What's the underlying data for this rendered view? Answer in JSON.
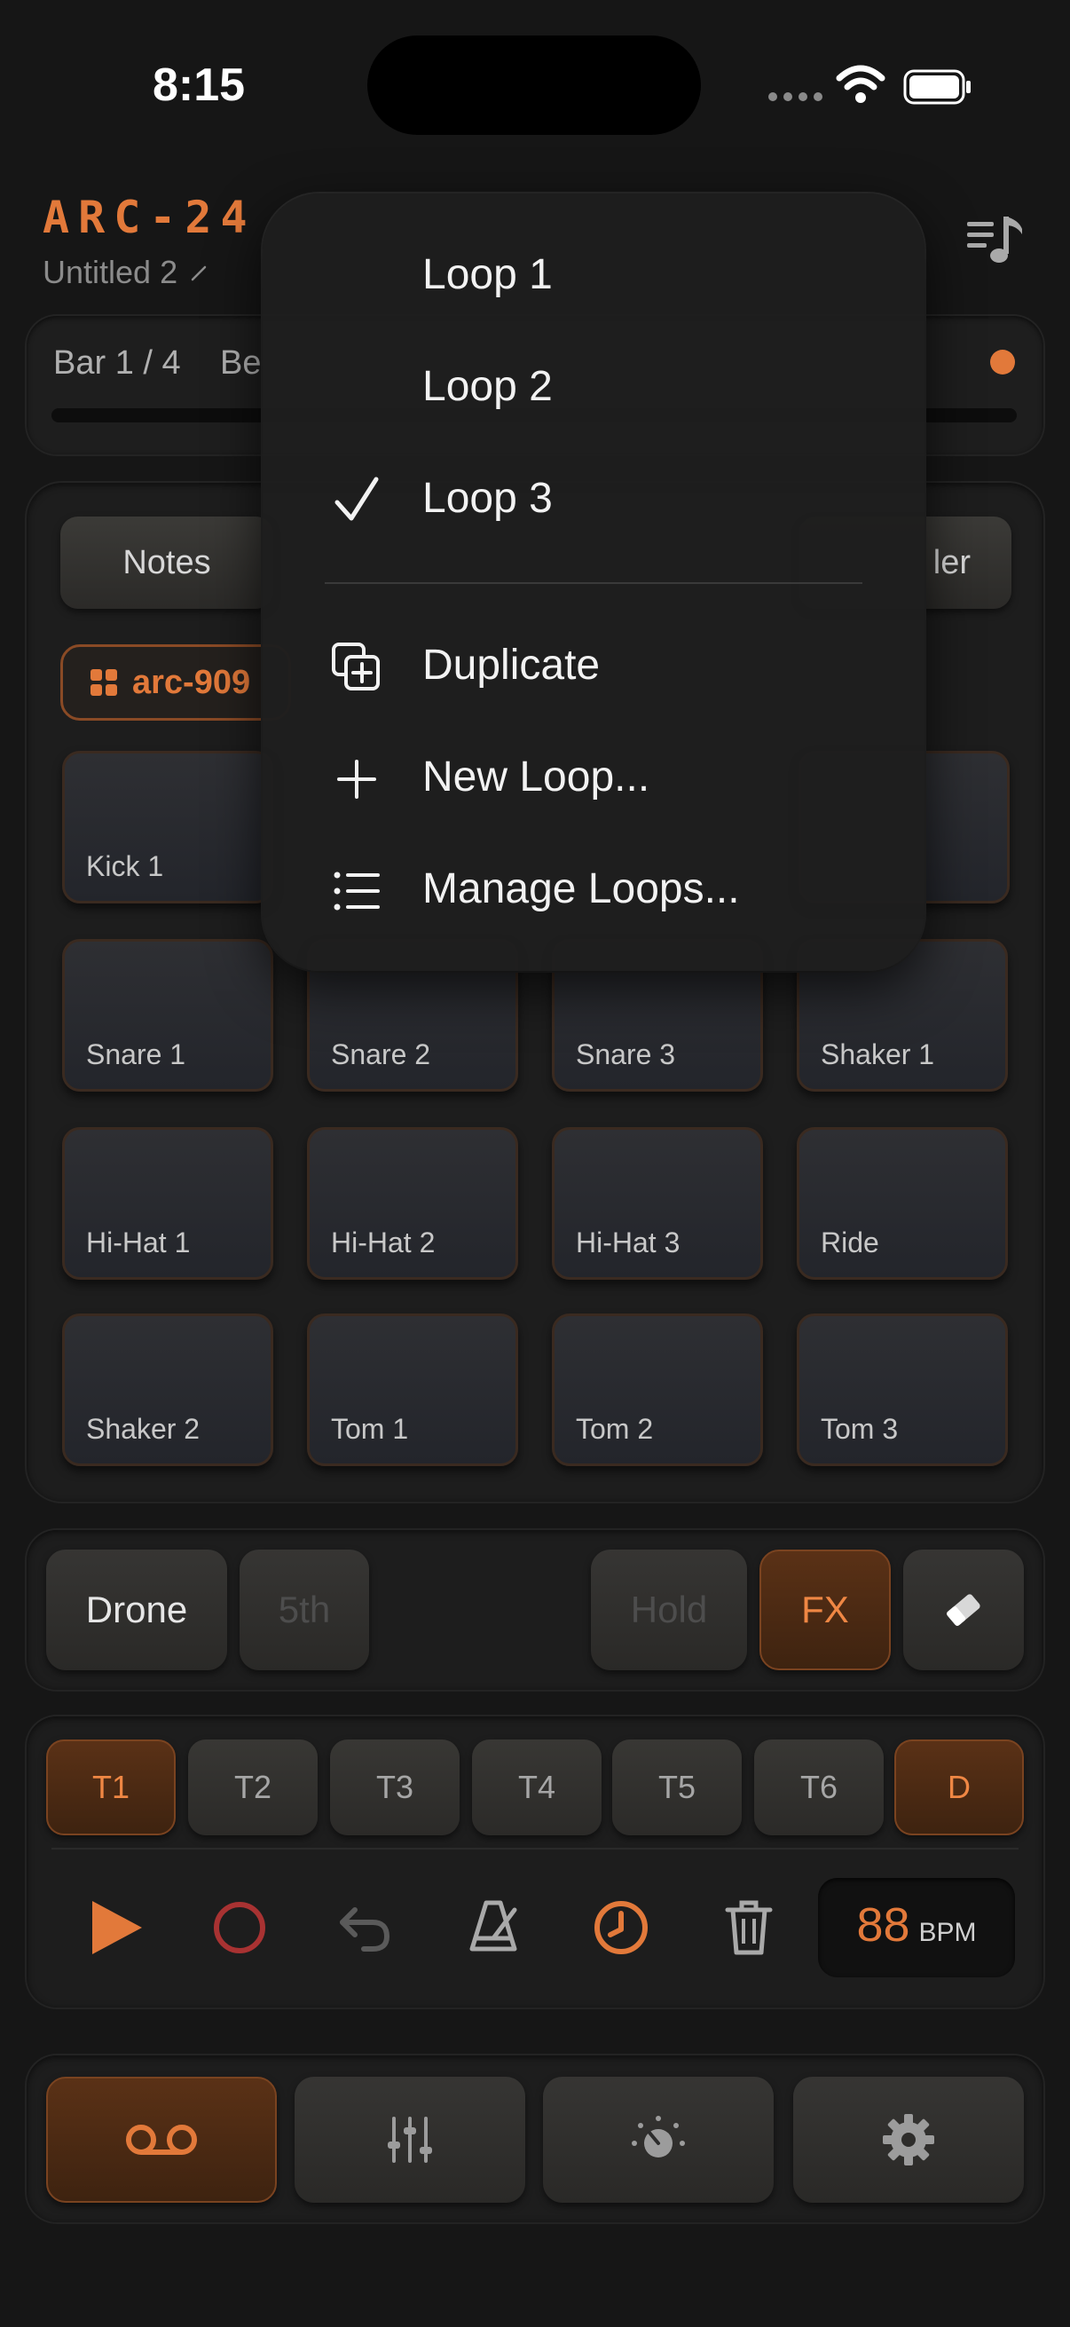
{
  "status_bar": {
    "time": "8:15"
  },
  "header": {
    "brand": "ARC-24",
    "project_name": "Untitled 2"
  },
  "transport_info": {
    "bar": "Bar 1 / 4",
    "beat_partial": "Be"
  },
  "pad_panel": {
    "mode_tabs": [
      "Notes",
      "ler"
    ],
    "kit_label": "arc-909",
    "pads": [
      "Kick 1",
      "",
      "",
      "",
      "Snare 1",
      "Snare 2",
      "Snare 3",
      "Shaker 1",
      "Hi-Hat 1",
      "Hi-Hat 2",
      "Hi-Hat 3",
      "Ride",
      "Shaker 2",
      "Tom 1",
      "Tom 2",
      "Tom 3"
    ]
  },
  "controls": {
    "drone": "Drone",
    "fifth": "5th",
    "hold": "Hold",
    "fx": "FX"
  },
  "tracks": {
    "items": [
      "T1",
      "T2",
      "T3",
      "T4",
      "T5",
      "T6",
      "D"
    ],
    "active": "T1"
  },
  "tempo": {
    "value": "88",
    "unit": "BPM"
  },
  "menu": {
    "loops": [
      "Loop 1",
      "Loop 2",
      "Loop 3"
    ],
    "selected_loop": "Loop 3",
    "actions": [
      "Duplicate",
      "New Loop...",
      "Manage Loops..."
    ]
  },
  "colors": {
    "accent": "#e2793a",
    "background": "#161616",
    "record": "#a83232"
  },
  "icons": {
    "pencil": "pencil-icon",
    "music": "music-list-icon",
    "grid": "grid-icon",
    "eraser": "eraser-icon",
    "play": "play-icon",
    "record": "record-icon",
    "undo": "undo-icon",
    "metronome": "metronome-icon",
    "clock": "clock-icon",
    "trash": "trash-icon",
    "tape": "tape-icon",
    "mixer": "mixer-icon",
    "knob": "knob-icon",
    "gear": "gear-icon",
    "check": "checkmark-icon",
    "duplicate": "duplicate-icon",
    "plus": "plus-icon",
    "list": "list-icon"
  }
}
